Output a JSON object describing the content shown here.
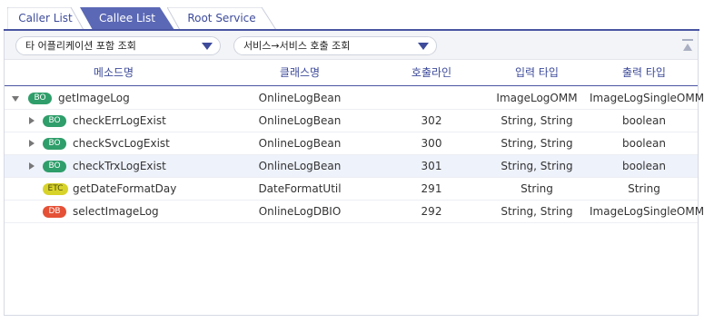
{
  "tabs": [
    {
      "label": "Caller List",
      "active": false
    },
    {
      "label": "Callee List",
      "active": true
    },
    {
      "label": "Root Service",
      "active": false
    }
  ],
  "toolbar": {
    "filter1_value": "타 어플리케이션 포함 조회",
    "filter2_value": "서비스→서비스 호출 조회"
  },
  "table": {
    "columns": [
      "메소드명",
      "클래스명",
      "호출라인",
      "입력 타입",
      "출력 타입"
    ],
    "rows": [
      {
        "toggle": "open",
        "badge": "BO",
        "method": "getImageLog",
        "class": "OnlineLogBean",
        "line": "",
        "input": "ImageLogOMM",
        "output": "ImageLogSingleOMM"
      },
      {
        "toggle": "closed",
        "badge": "BO",
        "method": "checkErrLogExist",
        "class": "OnlineLogBean",
        "line": "302",
        "input": "String, String",
        "output": "boolean"
      },
      {
        "toggle": "closed",
        "badge": "BO",
        "method": "checkSvcLogExist",
        "class": "OnlineLogBean",
        "line": "300",
        "input": "String, String",
        "output": "boolean"
      },
      {
        "toggle": "closed",
        "badge": "BO",
        "method": "checkTrxLogExist",
        "class": "OnlineLogBean",
        "line": "301",
        "input": "String, String",
        "output": "boolean"
      },
      {
        "toggle": "",
        "badge": "ETC",
        "method": "getDateFormatDay",
        "class": "DateFormatUtil",
        "line": "291",
        "input": "String",
        "output": "String"
      },
      {
        "toggle": "",
        "badge": "DB",
        "method": "selectImageLog",
        "class": "OnlineLogDBIO",
        "line": "292",
        "input": "String, String",
        "output": "ImageLogSingleOMM"
      }
    ]
  },
  "colors": {
    "accent": "#4a55a2",
    "active_tab": "#5b68b5",
    "badge_bo": "#2f9e6a",
    "badge_etc": "#d8d32a",
    "badge_db": "#e55136"
  }
}
